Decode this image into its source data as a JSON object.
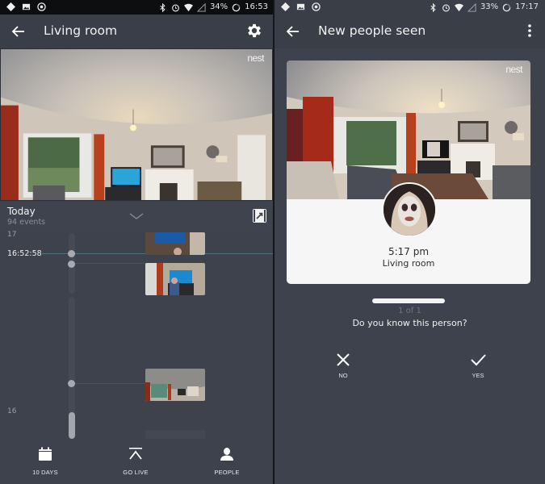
{
  "left_screen": {
    "status_bar": {
      "battery": "34%",
      "time": "16:53",
      "icons_left": [
        "diamond-notification-icon",
        "image-notification-icon",
        "nest-notification-icon"
      ],
      "icons_right": [
        "bluetooth-icon",
        "alarm-icon",
        "wifi-icon",
        "cell-signal-icon",
        "battery-icon"
      ]
    },
    "app_bar": {
      "title": "Living room",
      "back_icon": "arrow-left-icon",
      "action_icon": "gear-icon"
    },
    "camera": {
      "logo": "nest"
    },
    "day_header": {
      "title": "Today",
      "subtitle": "94 events",
      "expand_icon": "chevron-down-icon",
      "clip_icon": "video-clip-icon"
    },
    "timeline": {
      "top_tick": "17",
      "current_time": "16:52:58",
      "bottom_tick": "16",
      "events": [
        {
          "label": "event-tv-person-1"
        },
        {
          "label": "event-tv-person-2"
        },
        {
          "label": "event-room-wide"
        }
      ]
    },
    "bottom_nav": [
      {
        "label": "10 DAYS",
        "icon": "calendar-icon"
      },
      {
        "label": "GO LIVE",
        "icon": "go-live-icon"
      },
      {
        "label": "PEOPLE",
        "icon": "person-icon"
      }
    ]
  },
  "right_screen": {
    "status_bar": {
      "battery": "33%",
      "time": "17:17",
      "icons_left": [
        "diamond-notification-icon",
        "image-notification-icon",
        "nest-notification-icon"
      ],
      "icons_right": [
        "bluetooth-icon",
        "alarm-icon",
        "wifi-icon",
        "cell-signal-icon",
        "battery-icon"
      ]
    },
    "app_bar": {
      "title": "New people seen",
      "back_icon": "arrow-left-icon",
      "action_icon": "more-vert-icon"
    },
    "card": {
      "logo": "nest",
      "time": "5:17 pm",
      "room": "Living room"
    },
    "pager": {
      "count": "1 of 1"
    },
    "question": "Do you know this person?",
    "answers": [
      {
        "label": "NO",
        "icon": "close-icon"
      },
      {
        "label": "YES",
        "icon": "check-icon"
      }
    ]
  },
  "colors": {
    "background": "#3d424d",
    "app_bar": "#3a3e47",
    "card": "#f6f6f7",
    "now_line": "#4f6f7f"
  }
}
